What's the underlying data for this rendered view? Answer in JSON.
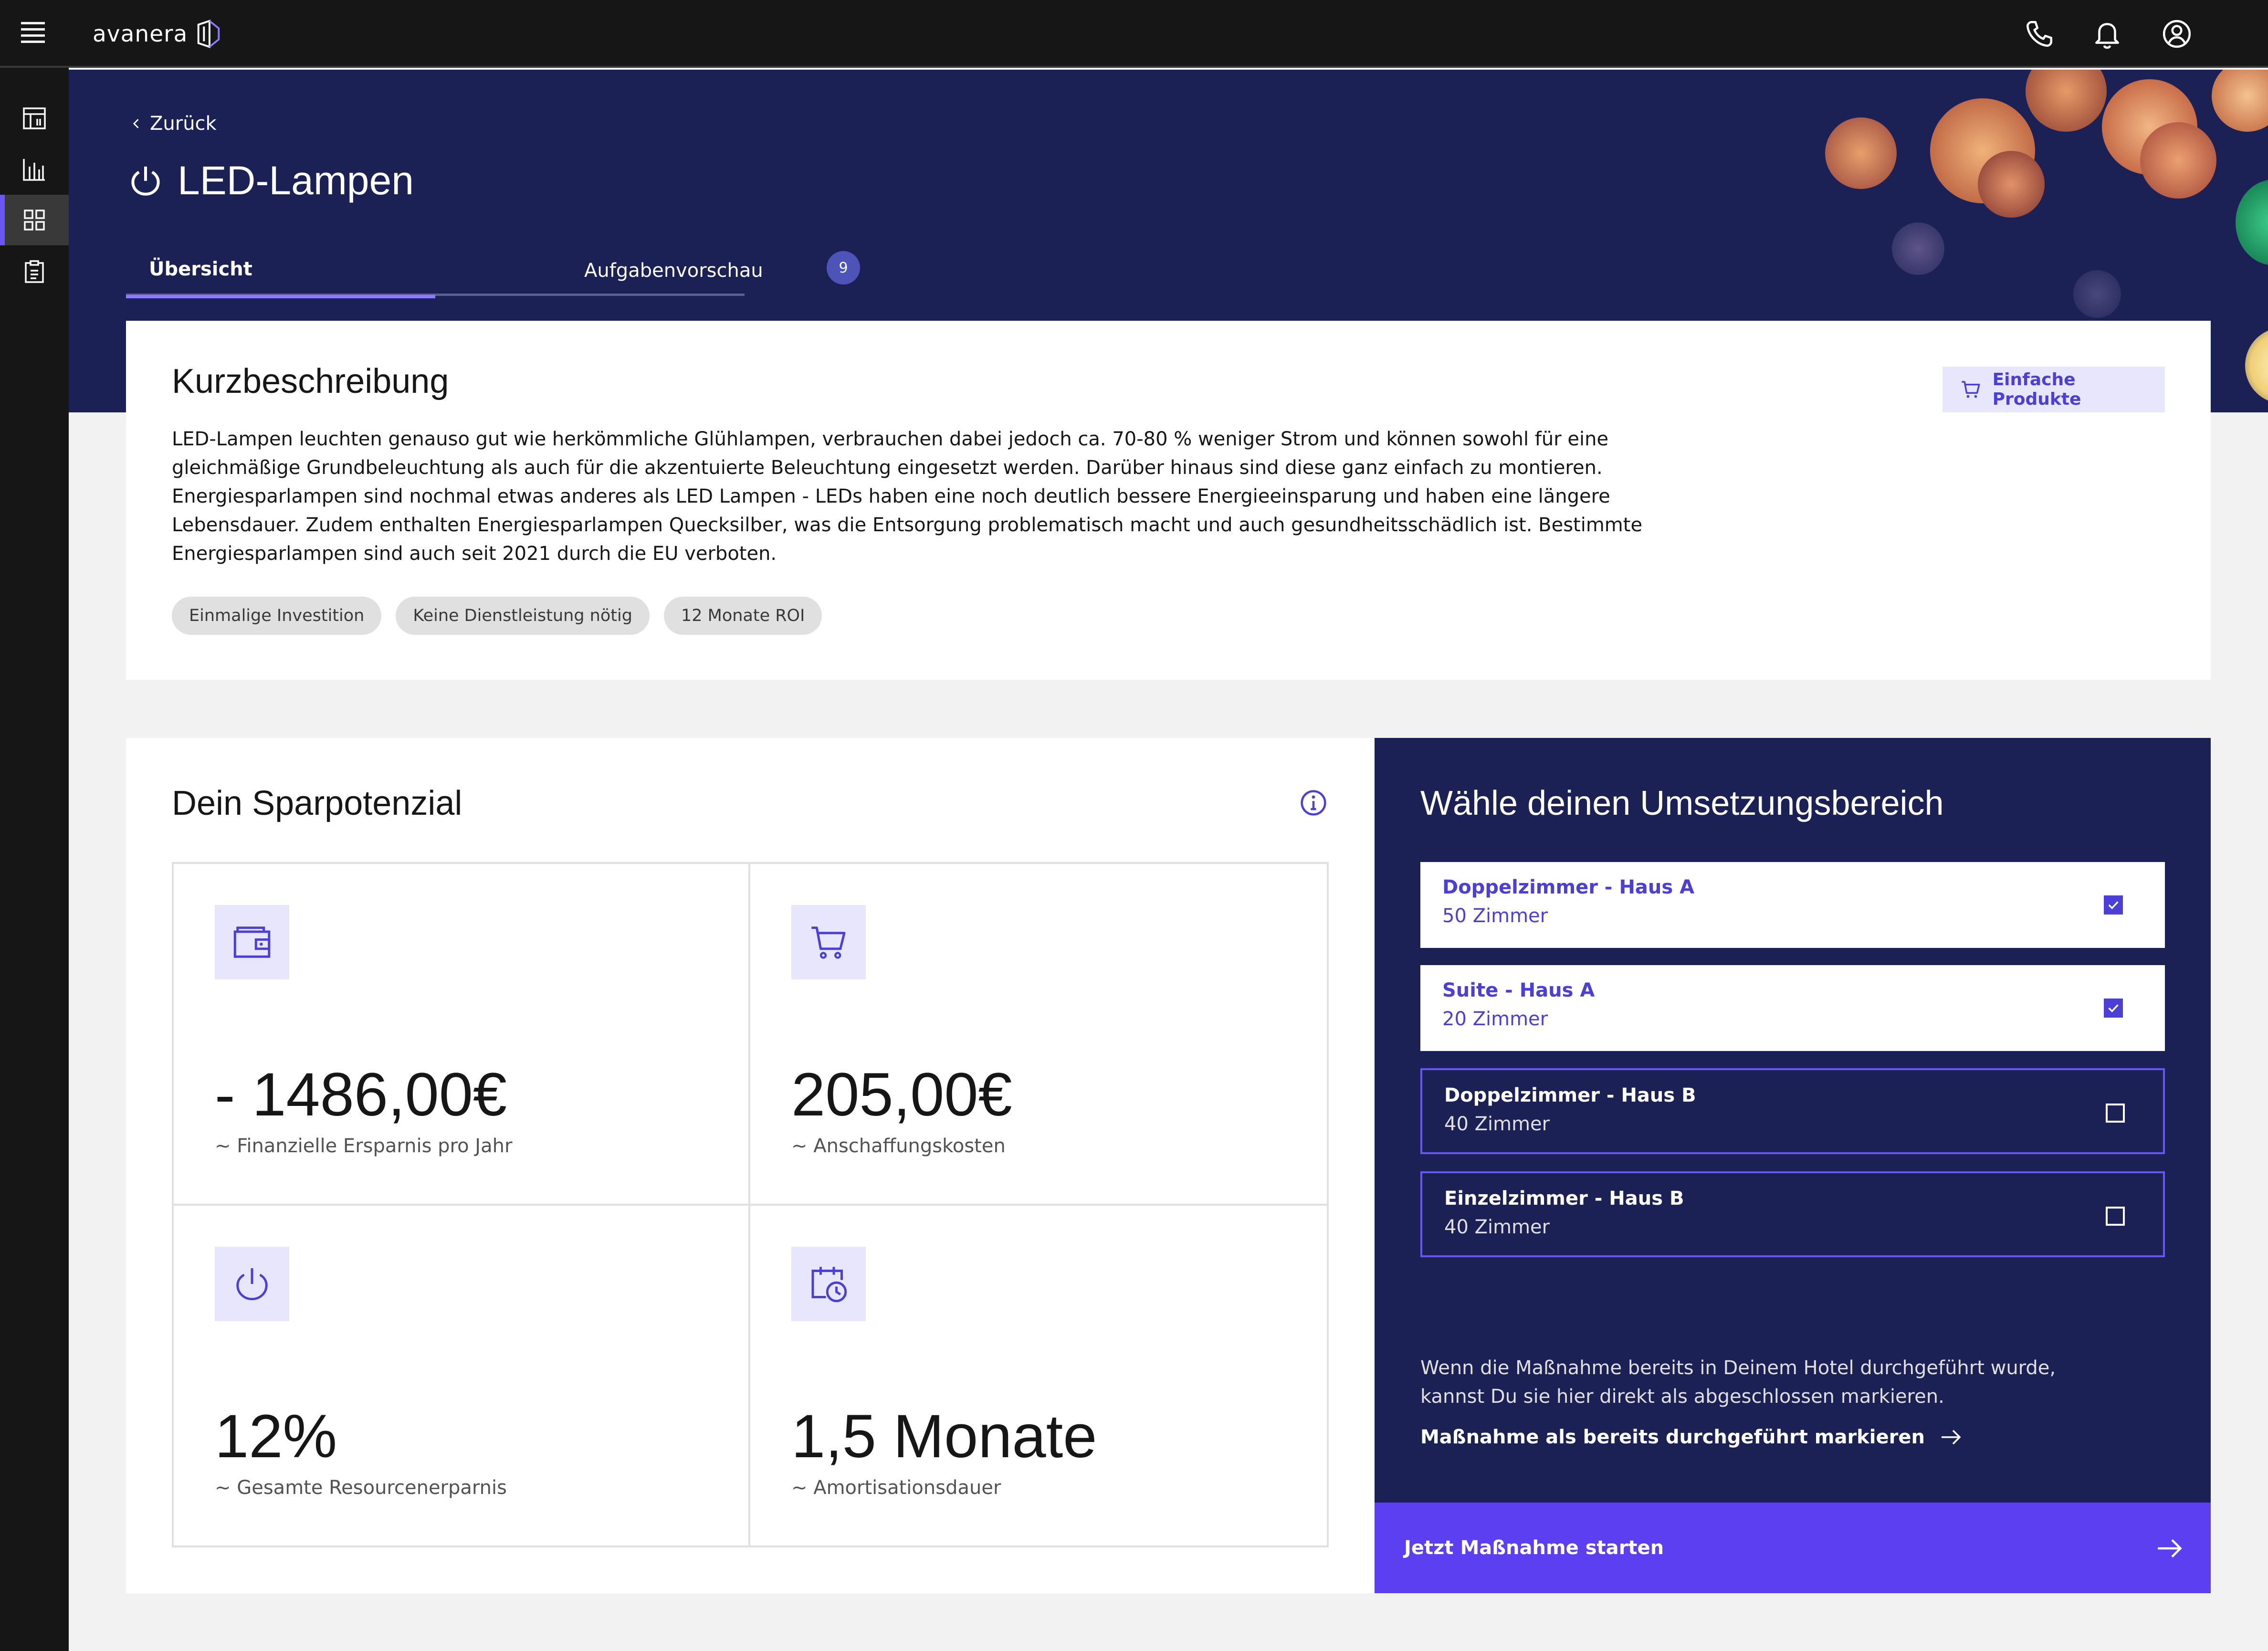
{
  "app": {
    "brand": "avanera"
  },
  "hero": {
    "back_label": "Zurück",
    "title": "LED-Lampen",
    "tabs": [
      {
        "label": "Übersicht",
        "active": true
      },
      {
        "label": "Aufgabenvorschau",
        "badge": "9"
      }
    ]
  },
  "description": {
    "title": "Kurzbeschreibung",
    "text": "LED-Lampen leuchten genauso gut wie herkömmliche Glühlampen, verbrauchen dabei jedoch ca. 70-80 % weniger Strom und können sowohl für eine gleichmäßige Grundbeleuchtung als auch für die akzentuierte Beleuchtung eingesetzt werden. Darüber hinaus sind diese ganz einfach zu montieren. Energiesparlampen sind nochmal etwas anderes als LED Lampen - LEDs haben eine noch deutlich bessere Energieeinsparung und haben eine längere Lebensdauer. Zudem enthalten Energiesparlampen Quecksilber, was die Entsorgung problematisch macht und auch gesundheitsschädlich ist. Bestimmte Energiesparlampen sind auch seit 2021 durch die EU verboten.",
    "chips": [
      "Einmalige Investition",
      "Keine Dienstleistung nötig",
      "12 Monate ROI"
    ],
    "products_button": "Einfache Produkte"
  },
  "savings": {
    "title": "Dein Sparpotenzial",
    "cells": [
      {
        "icon": "wallet-icon",
        "value": "- 1486,00€",
        "label": "~ Finanzielle Ersparnis pro Jahr"
      },
      {
        "icon": "cart-icon",
        "value": "205,00€",
        "label": "~ Anschaffungskosten"
      },
      {
        "icon": "power-icon",
        "value": "12%",
        "label": "~ Gesamte Resourcenerparnis"
      },
      {
        "icon": "calendar-clock-icon",
        "value": "1,5 Monate",
        "label": "~ Amortisationsdauer"
      }
    ]
  },
  "area": {
    "title": "Wähle deinen Umsetzungsbereich",
    "options": [
      {
        "name": "Doppelzimmer - Haus A",
        "rooms": "50 Zimmer",
        "checked": true
      },
      {
        "name": "Suite - Haus A",
        "rooms": "20 Zimmer",
        "checked": true
      },
      {
        "name": "Doppelzimmer - Haus B",
        "rooms": "40 Zimmer",
        "checked": false
      },
      {
        "name": "Einzelzimmer - Haus B",
        "rooms": "40 Zimmer",
        "checked": false
      }
    ],
    "note": "Wenn die Maßnahme bereits in Deinem Hotel durchgeführt wurde, kannst Du sie hier direkt als abgeschlossen markieren.",
    "mark_done_link": "Maßnahme als bereits durchgeführt markieren",
    "start_button": "Jetzt Maßnahme starten"
  },
  "colors": {
    "accent": "#5b3ff0",
    "navy": "#1c2155",
    "dark": "#161616",
    "icon_bg": "#e8e6fd"
  }
}
